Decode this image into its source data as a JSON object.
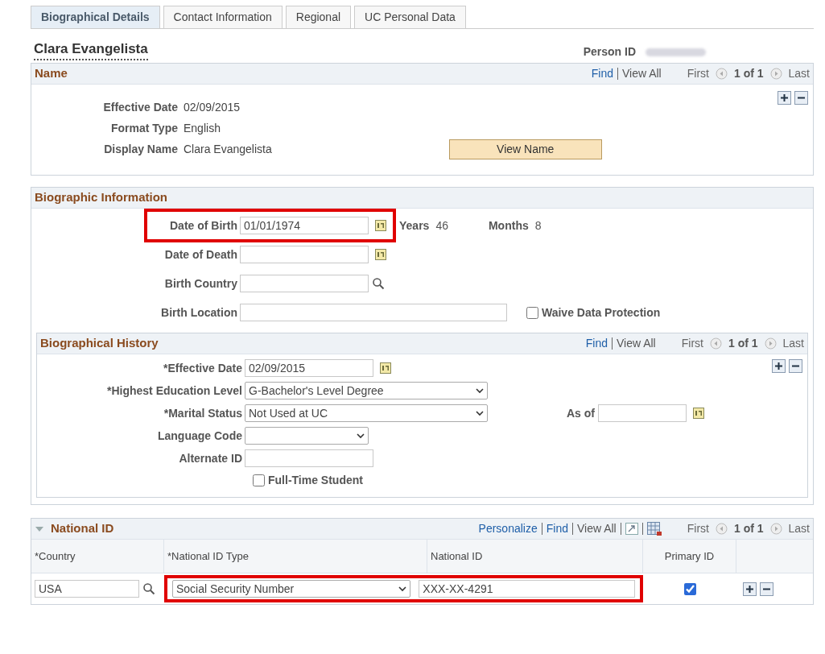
{
  "tabs": [
    {
      "label": "Biographical Details",
      "selected": true
    },
    {
      "label": "Contact Information",
      "selected": false
    },
    {
      "label": "Regional",
      "selected": false
    },
    {
      "label": "UC Personal Data",
      "selected": false
    }
  ],
  "person": {
    "name": "Clara Evangelista",
    "id_label": "Person ID"
  },
  "name_section": {
    "title": "Name",
    "nav": {
      "find": "Find",
      "view_all": "View All",
      "first": "First",
      "count": "1 of 1",
      "last": "Last"
    },
    "fields": [
      {
        "label": "Effective Date",
        "value": "02/09/2015"
      },
      {
        "label": "Format Type",
        "value": "English"
      },
      {
        "label": "Display Name",
        "value": "Clara Evangelista"
      }
    ],
    "button": "View Name"
  },
  "biographic_information": {
    "title": "Biographic Information",
    "fields": [
      {
        "kind": "date",
        "label": "Date of Birth",
        "value": "01/01/1974",
        "highlighted": true
      },
      {
        "kind": "date",
        "label": "Date of Death",
        "highlighted": false
      },
      {
        "kind": "lookup",
        "label": "Birth Country",
        "highlighted": false
      },
      {
        "kind": "wide",
        "label": "Birth Location",
        "highlighted": false
      }
    ],
    "years_label": "Years",
    "years": "46",
    "months_label": "Months",
    "months": "8",
    "waive": {
      "label": "Waive Data Protection",
      "checked": false
    }
  },
  "biographical_history": {
    "title": "Biographical History",
    "nav": {
      "find": "Find",
      "view_all": "View All",
      "first": "First",
      "count": "1 of 1",
      "last": "Last"
    },
    "fields": [
      {
        "kind": "date",
        "label": "*Effective Date",
        "value": "02/09/2015"
      },
      {
        "kind": "select",
        "label": "*Highest Education Level",
        "value": "G-Bachelor's Level Degree"
      },
      {
        "kind": "select",
        "label": "*Marital Status",
        "value": "Not Used at UC"
      },
      {
        "kind": "short-select",
        "label": "Language Code"
      },
      {
        "kind": "text",
        "label": "Alternate ID"
      }
    ],
    "as_of_label": "As of",
    "full_time": {
      "label": "Full-Time Student",
      "checked": false
    }
  },
  "national_id": {
    "title": "National ID",
    "expanded": true,
    "nav": {
      "personalize": "Personalize",
      "find": "Find",
      "view_all": "View All",
      "first": "First",
      "count": "1 of 1",
      "last": "Last"
    },
    "columns": [
      "*Country",
      "*National ID Type",
      "National ID",
      "Primary ID"
    ],
    "rows": [
      {
        "country": "USA",
        "type": "Social Security Number",
        "national_id": "XXX-XX-4291",
        "primary": true,
        "highlighted": true
      }
    ]
  }
}
